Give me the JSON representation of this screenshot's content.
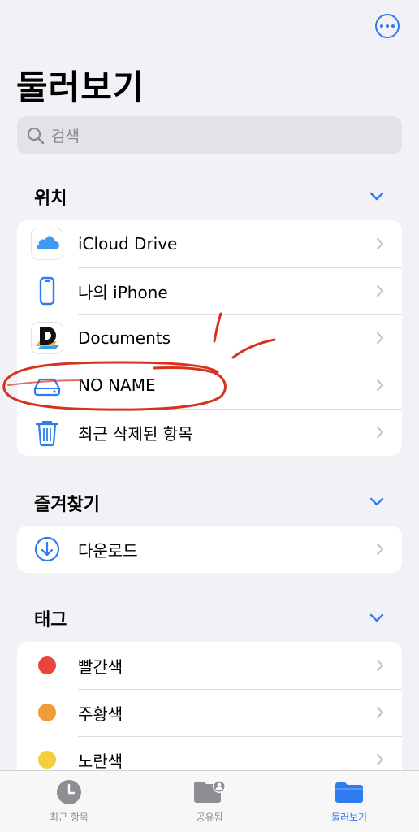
{
  "header": {
    "title": "둘러보기",
    "more_icon": "ellipsis-circle-icon"
  },
  "search": {
    "placeholder": "검색"
  },
  "sections": {
    "locations": {
      "title": "위치",
      "items": [
        {
          "label": "iCloud Drive",
          "icon": "icloud-icon"
        },
        {
          "label": "나의 iPhone",
          "icon": "iphone-icon"
        },
        {
          "label": "Documents",
          "icon": "documents-app-icon"
        },
        {
          "label": "NO NAME",
          "icon": "external-drive-icon"
        },
        {
          "label": "최근 삭제된 항목",
          "icon": "trash-icon"
        }
      ]
    },
    "favorites": {
      "title": "즐겨찾기",
      "items": [
        {
          "label": "다운로드",
          "icon": "download-circle-icon"
        }
      ]
    },
    "tags": {
      "title": "태그",
      "items": [
        {
          "label": "빨간색",
          "color": "#e8453c"
        },
        {
          "label": "주황색",
          "color": "#f29a35"
        },
        {
          "label": "노란색",
          "color": "#f5cd3d"
        }
      ]
    }
  },
  "tabbar": {
    "items": [
      {
        "label": "최근 항목",
        "icon": "clock-icon"
      },
      {
        "label": "공유됨",
        "icon": "shared-folder-icon"
      },
      {
        "label": "둘러보기",
        "icon": "folder-icon"
      }
    ],
    "active_color": "#2f7bf0"
  }
}
